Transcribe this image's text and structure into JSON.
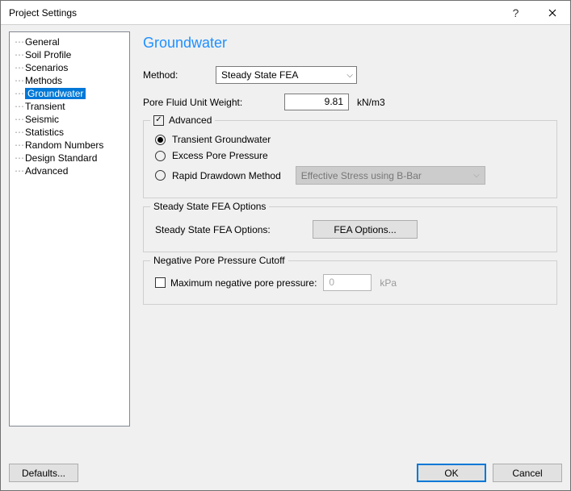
{
  "window": {
    "title": "Project Settings"
  },
  "nav": {
    "items": [
      {
        "label": "General"
      },
      {
        "label": "Soil Profile"
      },
      {
        "label": "Scenarios"
      },
      {
        "label": "Methods"
      },
      {
        "label": "Groundwater",
        "selected": true
      },
      {
        "label": "Transient"
      },
      {
        "label": "Seismic"
      },
      {
        "label": "Statistics"
      },
      {
        "label": "Random Numbers"
      },
      {
        "label": "Design Standard"
      },
      {
        "label": "Advanced"
      }
    ]
  },
  "page": {
    "heading": "Groundwater",
    "method_label": "Method:",
    "method_value": "Steady State FEA",
    "pore_label": "Pore Fluid Unit Weight:",
    "pore_value": "9.81",
    "pore_unit": "kN/m3",
    "advanced": {
      "title": "Advanced",
      "checked": true,
      "options": {
        "transient": "Transient Groundwater",
        "excess": "Excess Pore Pressure",
        "rapid": "Rapid Drawdown Method",
        "rapid_select": "Effective Stress using B-Bar",
        "selected": "transient"
      }
    },
    "fea": {
      "title": "Steady State FEA Options",
      "label": "Steady State FEA Options:",
      "button": "FEA Options..."
    },
    "negative": {
      "title": "Negative Pore Pressure Cutoff",
      "label": "Maximum negative pore pressure:",
      "value": "0",
      "unit": "kPa",
      "checked": false
    }
  },
  "footer": {
    "defaults": "Defaults...",
    "ok": "OK",
    "cancel": "Cancel"
  }
}
